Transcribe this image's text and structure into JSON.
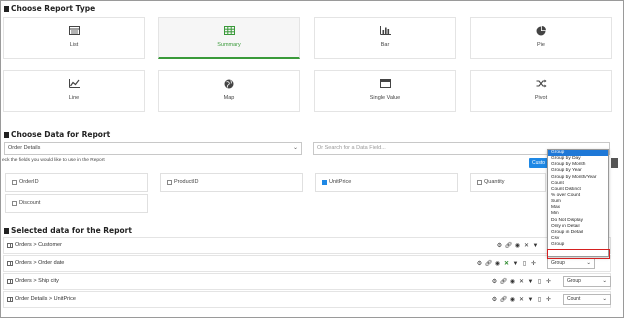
{
  "report_type": {
    "title": "Choose Report Type",
    "cards": [
      {
        "label": "List",
        "icon": "list-icon"
      },
      {
        "label": "Summary",
        "icon": "summary-grid-icon",
        "active": true
      },
      {
        "label": "Bar",
        "icon": "bar-chart-icon"
      },
      {
        "label": "Pie",
        "icon": "pie-chart-icon"
      },
      {
        "label": "Line",
        "icon": "line-chart-icon"
      },
      {
        "label": "Map",
        "icon": "globe-icon"
      },
      {
        "label": "Single Value",
        "icon": "single-value-icon"
      },
      {
        "label": "Pivot",
        "icon": "pivot-icon"
      }
    ]
  },
  "data_section": {
    "title": "Choose Data for Report",
    "source_select": "Order Details",
    "search_placeholder": "Or Search for a Data Field...",
    "hint": "eck the fields you would like to use in the Report",
    "blue_button": "Custo",
    "fields": [
      {
        "label": "OrderID",
        "checked": false
      },
      {
        "label": "ProductID",
        "checked": false
      },
      {
        "label": "UnitPrice",
        "checked": true
      },
      {
        "label": "Quantity",
        "checked": false
      },
      {
        "label": "Discount",
        "checked": false
      }
    ]
  },
  "selected_section": {
    "title": "Selected data for the Report",
    "rows": [
      {
        "label": "Orders > Customer",
        "aggregate": ""
      },
      {
        "label": "Orders > Order date",
        "aggregate": "Group"
      },
      {
        "label": "Orders > Ship city",
        "aggregate": "Group"
      },
      {
        "label": "Order Details > UnitPrice",
        "aggregate": "Count"
      }
    ]
  },
  "dropdown": {
    "options": [
      "Group",
      "Group by Day",
      "Group by Month",
      "Group by Year",
      "Group by Month/Year",
      "Count",
      "Count Distinct",
      "% over Count",
      "Sum",
      "Max",
      "Min",
      "Do Not Display",
      "Only in Detail",
      "Group in Detail",
      "Csv",
      "Group"
    ],
    "selected_index": 0,
    "highlighted_option": "Csv"
  },
  "colors": {
    "accent_green": "#3a9a3a",
    "selection_blue": "#1e78d7",
    "highlight_red": "#d42020"
  }
}
